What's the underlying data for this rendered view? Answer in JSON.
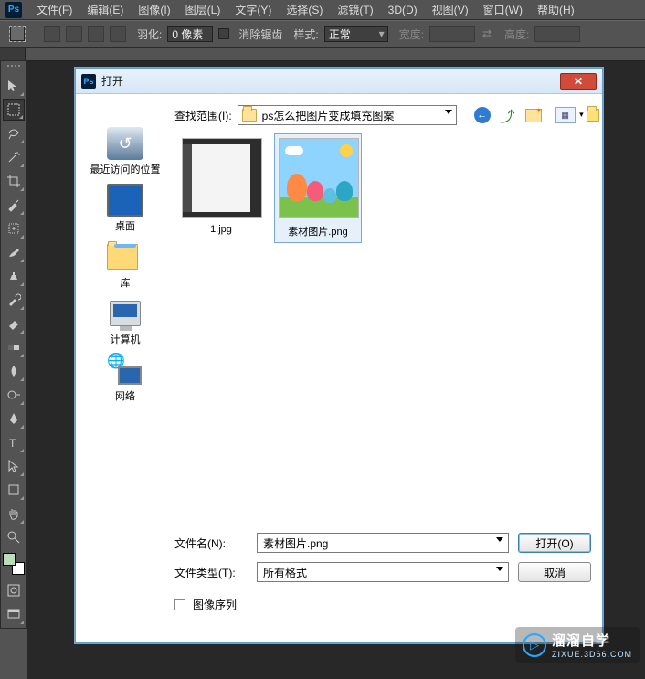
{
  "app": {
    "logo_text": "Ps"
  },
  "menubar": {
    "items": [
      "文件(F)",
      "编辑(E)",
      "图像(I)",
      "图层(L)",
      "文字(Y)",
      "选择(S)",
      "滤镜(T)",
      "3D(D)",
      "视图(V)",
      "窗口(W)",
      "帮助(H)"
    ]
  },
  "optionsbar": {
    "feather_label": "羽化:",
    "feather_value": "0 像素",
    "antialias_label": "消除锯齿",
    "style_label": "样式:",
    "style_value": "正常",
    "width_label": "宽度:",
    "height_label": "高度:"
  },
  "tools": [
    "move-tool",
    "marquee-tool",
    "lasso-tool",
    "magic-wand-tool",
    "crop-tool",
    "eyedropper-tool",
    "healing-brush-tool",
    "brush-tool",
    "clone-stamp-tool",
    "history-brush-tool",
    "eraser-tool",
    "gradient-tool",
    "blur-tool",
    "dodge-tool",
    "pen-tool",
    "type-tool",
    "path-select-tool",
    "shape-tool",
    "hand-tool",
    "zoom-tool"
  ],
  "dialog": {
    "title": "打开",
    "lookin_label": "查找范围(I):",
    "lookin_value": "ps怎么把图片变成填充图案",
    "places": {
      "recent": "最近访问的位置",
      "desktop": "桌面",
      "libraries": "库",
      "computer": "计算机",
      "network": "网络"
    },
    "files": [
      {
        "name": "1.jpg",
        "thumb": "ps-ui",
        "selected": false
      },
      {
        "name": "素材图片.png",
        "thumb": "peppa",
        "selected": true
      }
    ],
    "filename_label": "文件名(N):",
    "filename_value": "素材图片.png",
    "filetype_label": "文件类型(T):",
    "filetype_value": "所有格式",
    "open_btn": "打开(O)",
    "cancel_btn": "取消",
    "sequence_label": "图像序列"
  },
  "watermark": {
    "brand": "溜溜自学",
    "url": "ZIXUE.3D66.COM",
    "icon": "▷"
  }
}
